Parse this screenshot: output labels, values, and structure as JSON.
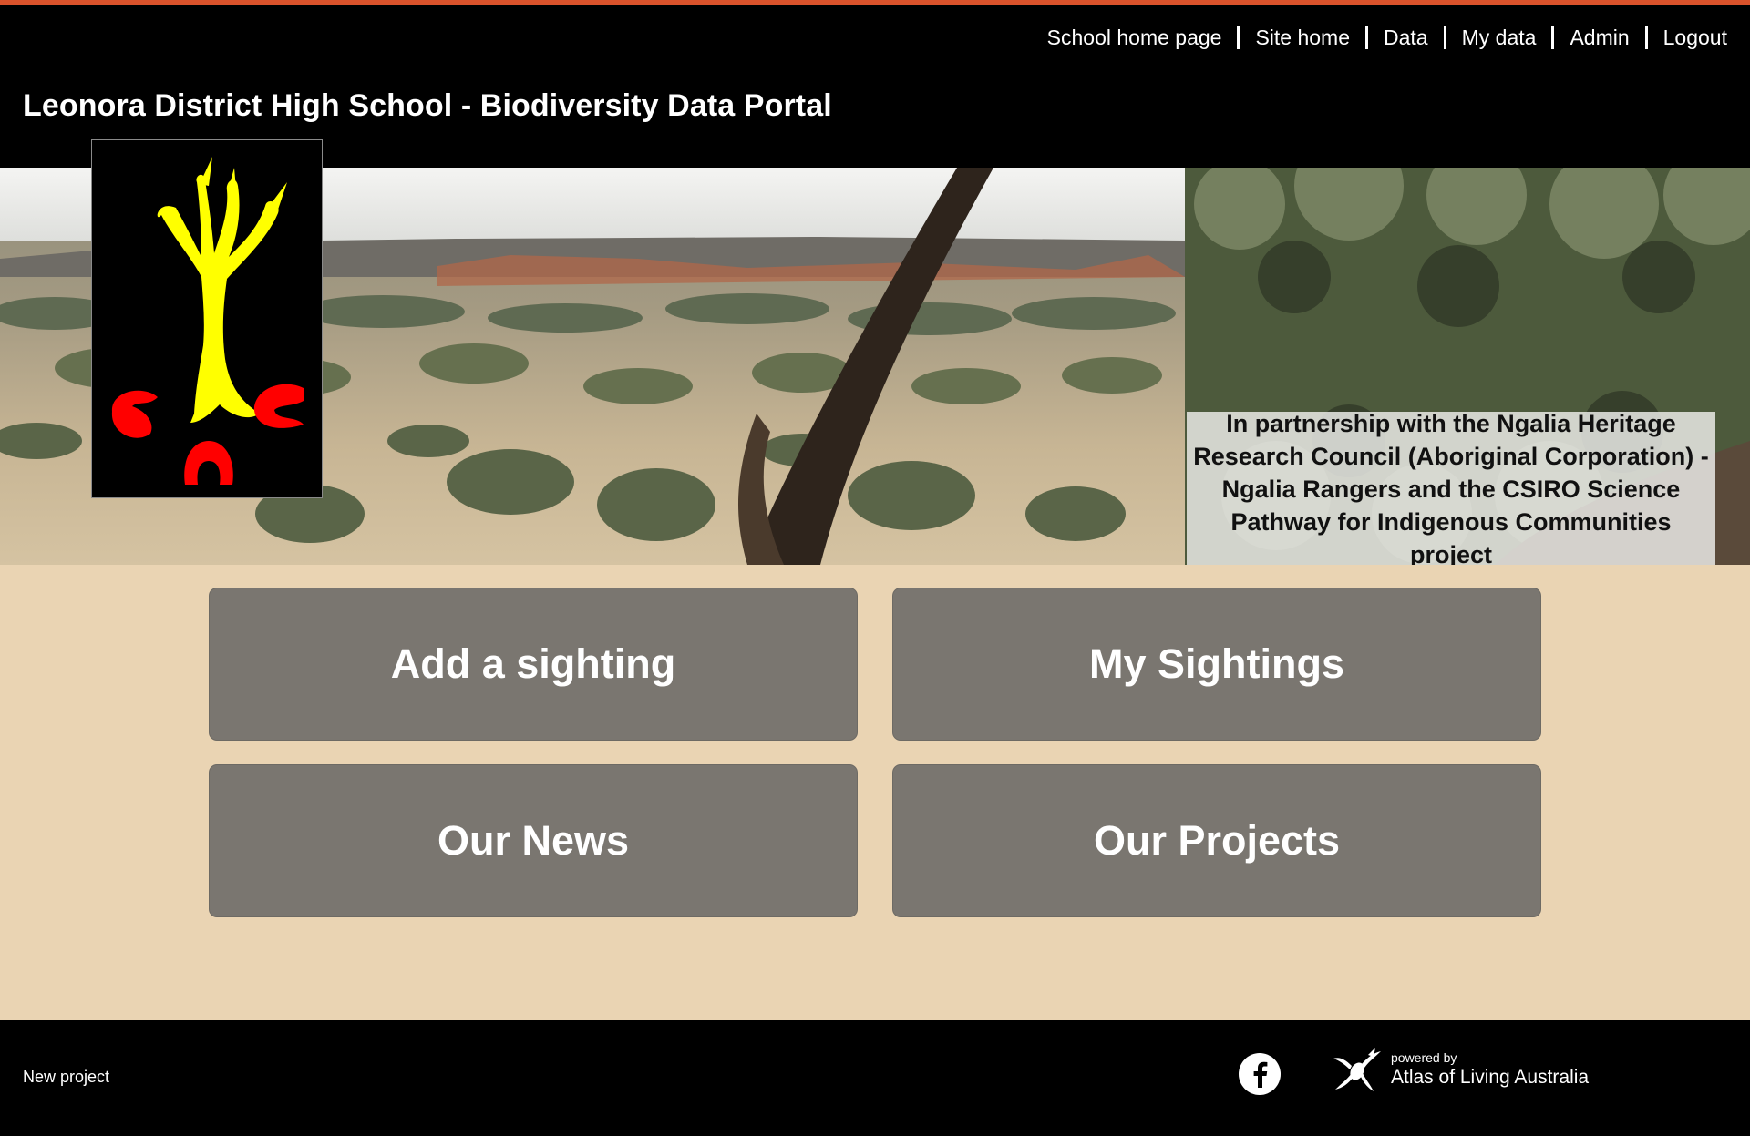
{
  "colors": {
    "accent_line": "#d9522b",
    "header_bg": "#000000",
    "content_bg": "#ead4b3",
    "tile_bg": "#7a7670",
    "logo_tree": "#ffff00",
    "logo_marks": "#ff0000"
  },
  "topnav": {
    "items": [
      {
        "label": "School home page"
      },
      {
        "label": "Site home"
      },
      {
        "label": "Data"
      },
      {
        "label": "My data"
      },
      {
        "label": "Admin"
      },
      {
        "label": "Logout"
      }
    ]
  },
  "header": {
    "title": "Leonora District High School - Biodiversity Data Portal"
  },
  "banner": {
    "partnership_text": "In partnership with the Ngalia Heritage Research Council (Aboriginal Corporation) - Ngalia Rangers and the CSIRO Science Pathway for Indigenous Communities project",
    "logo_icon": "tree-logo-icon"
  },
  "tiles": [
    {
      "label": "Add a sighting"
    },
    {
      "label": "My Sightings"
    },
    {
      "label": "Our News"
    },
    {
      "label": "Our Projects"
    }
  ],
  "footer": {
    "new_project": "New project",
    "facebook_icon": "facebook-icon",
    "powered_by": "powered by",
    "ala_name": "Atlas of Living Australia",
    "ala_icon": "ala-logo-icon"
  }
}
